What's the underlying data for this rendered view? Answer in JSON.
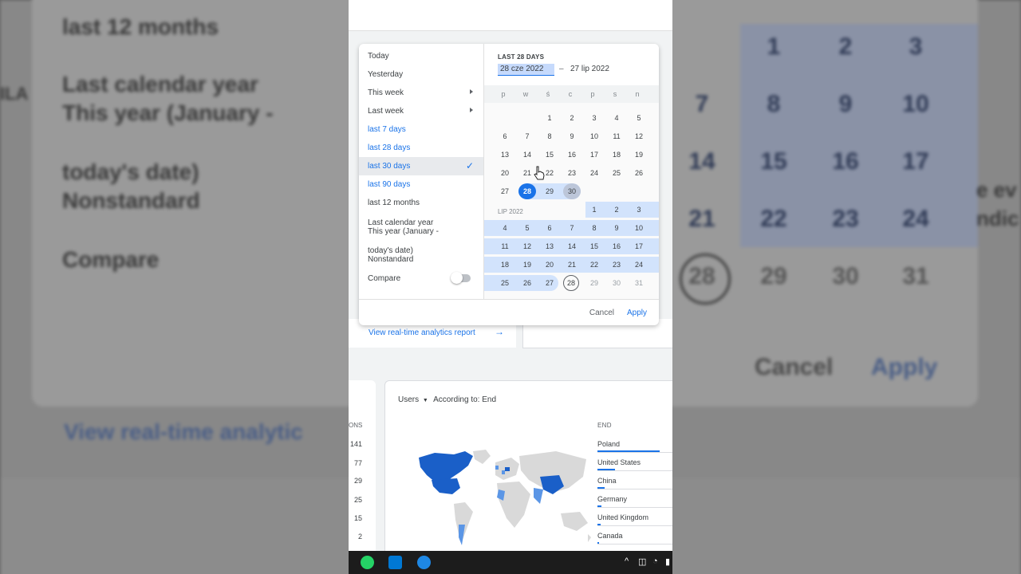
{
  "background": {
    "texts": [
      "last 12 months",
      "Last calendar year",
      "This year (January -",
      "today's date)",
      "Nonstandard",
      "Compare"
    ],
    "cal_numbers": [
      "1",
      "2",
      "3",
      "7",
      "8",
      "9",
      "10",
      "14",
      "15",
      "16",
      "17",
      "21",
      "22",
      "23",
      "24",
      "28",
      "29",
      "30",
      "31"
    ],
    "cancel_label": "Cancel",
    "apply_label": "Apply",
    "link_text": "View real-time analytic",
    "edge_texts": [
      "ILA",
      "e ev",
      "ndic"
    ]
  },
  "presets": [
    {
      "label": "Today",
      "style": "normal"
    },
    {
      "label": "Yesterday",
      "style": "normal"
    },
    {
      "label": "This week",
      "style": "normal",
      "submenu": true
    },
    {
      "label": "Last week",
      "style": "normal",
      "submenu": true
    },
    {
      "label": "last 7 days",
      "style": "blue"
    },
    {
      "label": "last 28 days",
      "style": "blue"
    },
    {
      "label": "last 30 days",
      "style": "blue",
      "selected": true
    },
    {
      "label": "last 90 days",
      "style": "blue"
    },
    {
      "label": "last 12 months",
      "style": "normal"
    }
  ],
  "preset_multiline": [
    {
      "line1": "Last calendar year",
      "line2": "This year (January -"
    },
    {
      "line1": "today's date)",
      "line2": "Nonstandard"
    }
  ],
  "compare_label": "Compare",
  "calendar": {
    "range_label": "LAST 28 DAYS",
    "start_date": "28 cze 2022",
    "separator": "–",
    "end_date": "27 lip 2022",
    "weekdays": [
      "p",
      "w",
      "ś",
      "c",
      "p",
      "s",
      "n"
    ],
    "june_rows": [
      [
        "",
        "",
        "1",
        "2",
        "3",
        "4",
        "5"
      ],
      [
        "6",
        "7",
        "8",
        "9",
        "10",
        "11",
        "12"
      ],
      [
        "13",
        "14",
        "15",
        "16",
        "17",
        "18",
        "19"
      ],
      [
        "20",
        "21",
        "22",
        "23",
        "24",
        "25",
        "26"
      ],
      [
        "27",
        "28",
        "29",
        "30",
        "",
        "",
        ""
      ]
    ],
    "july_label": "LIP 2022",
    "july_rows": [
      [
        "",
        "",
        "",
        "",
        "1",
        "2",
        "3"
      ],
      [
        "4",
        "5",
        "6",
        "7",
        "8",
        "9",
        "10"
      ],
      [
        "11",
        "12",
        "13",
        "14",
        "15",
        "16",
        "17"
      ],
      [
        "18",
        "19",
        "20",
        "21",
        "22",
        "23",
        "24"
      ],
      [
        "25",
        "26",
        "27",
        "28",
        "29",
        "30",
        "31"
      ]
    ]
  },
  "footer": {
    "cancel": "Cancel",
    "apply": "Apply"
  },
  "realtime_link": "View real-time analytics report",
  "left_numbers": [
    "ONS",
    "141",
    "77",
    "29",
    "25",
    "15",
    "2"
  ],
  "map_card": {
    "metric": "Users",
    "according": "According to: End",
    "column_header": "END",
    "countries": [
      "Poland",
      "United States",
      "China",
      "Germany",
      "United Kingdom",
      "Canada"
    ],
    "shares": [
      1.0,
      0.28,
      0.12,
      0.06,
      0.05,
      0.03
    ]
  },
  "colors": {
    "accent": "#1a73e8",
    "range": "#d2e3fc",
    "map_strong": "#1a5fc8",
    "map_light": "#5b96e6",
    "map_base": "#d9d9d9"
  }
}
